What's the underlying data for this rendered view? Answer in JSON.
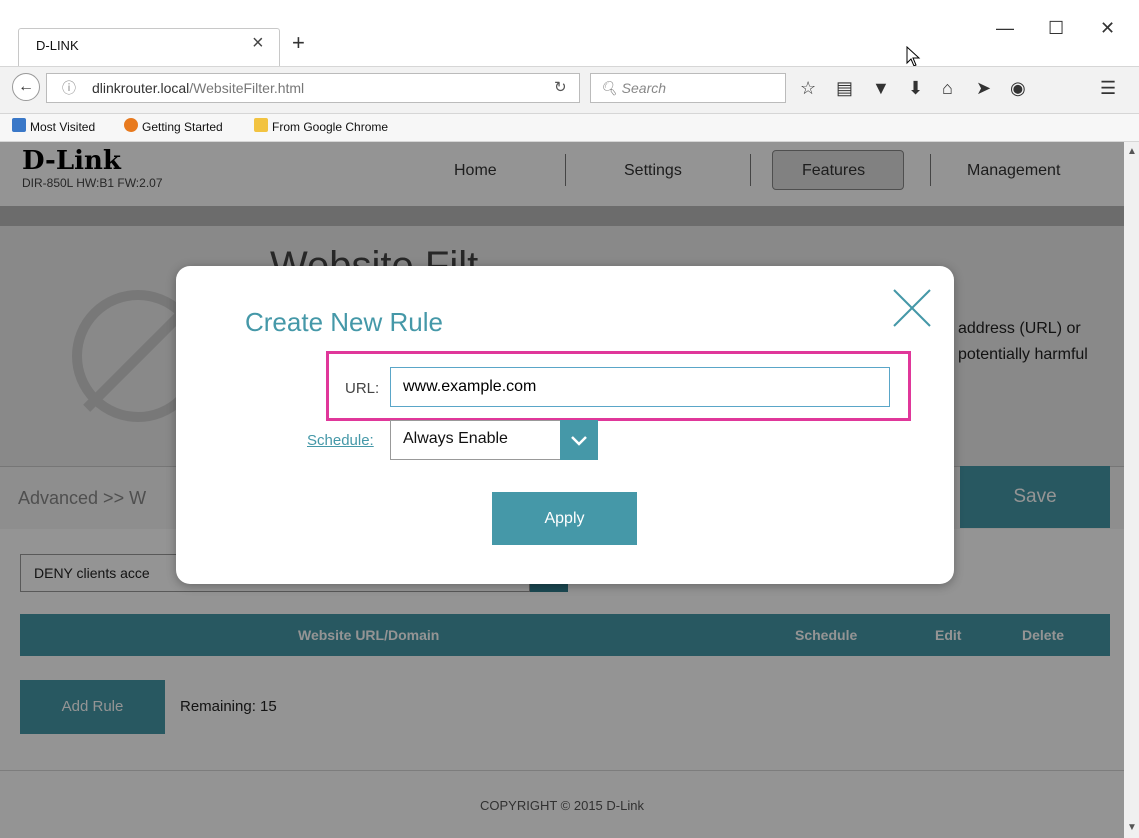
{
  "browser": {
    "tab_title": "D-LINK",
    "tab_close": "×",
    "new_tab": "+",
    "url_host": "dlinkrouter.local",
    "url_path": "/WebsiteFilter.html",
    "search_placeholder": "Search",
    "window_controls": {
      "minimize": "—",
      "maximize": "☐",
      "close": "✕"
    },
    "bookmarks": [
      "Most Visited",
      "Getting Started",
      "From Google Chrome"
    ]
  },
  "router_page": {
    "logo": "D-Link",
    "model_info": "DIR-850L  HW:B1  FW:2.07",
    "nav": {
      "home": "Home",
      "settings": "Settings",
      "features": "Features",
      "management": "Management"
    },
    "title": "Website Filt",
    "desc_line1": "address (URL) or",
    "desc_line2": "potentially harmful",
    "breadcrumb": "Advanced >> W",
    "save": "Save",
    "policy_select": "DENY clients acce",
    "table": {
      "col_url": "Website URL/Domain",
      "col_schedule": "Schedule",
      "col_edit": "Edit",
      "col_delete": "Delete"
    },
    "add_rule": "Add Rule",
    "remaining": "Remaining: 15",
    "copyright": "COPYRIGHT © 2015 D-Link"
  },
  "dialog": {
    "title": "Create New Rule",
    "url_label": "URL:",
    "url_value": "www.example.com",
    "schedule_label": "Schedule:",
    "schedule_value": "Always Enable",
    "apply": "Apply"
  },
  "colors": {
    "accent": "#4598a8",
    "highlight": "#e0379a"
  }
}
